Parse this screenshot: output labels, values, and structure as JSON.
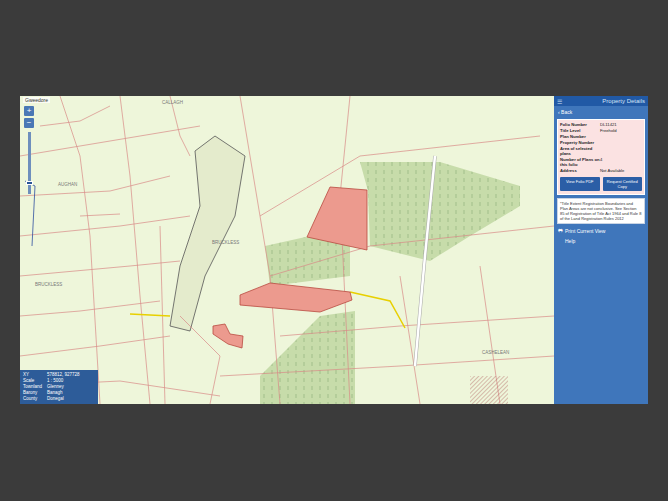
{
  "window": {
    "background": "map"
  },
  "map": {
    "search": "Gweedore",
    "zoom": {
      "in": "+",
      "out": "−",
      "level": 0.15
    },
    "labels": [
      "AUGHAN",
      "BRUCKLESS",
      "BRUCKLESS",
      "CASHELEAN",
      "CALLAGH"
    ],
    "plots": [
      {
        "selected": true
      },
      {
        "selected": true
      },
      {
        "selected": true
      }
    ],
    "info": [
      {
        "label": "XY",
        "value": "578812, 927728"
      },
      {
        "label": "Scale",
        "value": "1 : 5000"
      },
      {
        "label": "Townland",
        "value": "Glenney"
      },
      {
        "label": "Barony",
        "value": "Banagh"
      },
      {
        "label": "County",
        "value": "Donegal"
      }
    ]
  },
  "panel": {
    "menu": "☰",
    "title": "Property Details",
    "back": "‹ Back",
    "fields": [
      {
        "label": "Folio Number",
        "value": "DL11421"
      },
      {
        "label": "Title Level",
        "value": "Freehold"
      },
      {
        "label": "Plan Number",
        "value": ""
      },
      {
        "label": "Property Number",
        "value": ""
      },
      {
        "label": "Area of selected plans",
        "value": ""
      },
      {
        "label": "Number of Plans on this folio",
        "value": "4"
      },
      {
        "label": "Address",
        "value": "Not Available"
      }
    ],
    "buttons": [
      "View Folio PDF",
      "Request Certified Copy"
    ],
    "note": "*Title Extent Registration Boundaries and Plan Areas are not conclusive. See Section 85 of Registration of Title Act 1964 and Rule 8 of the Land Registration Rules 2012",
    "links": [
      {
        "icon": "🖶",
        "label": "Print Current View"
      },
      {
        "icon": "",
        "label": "Help"
      }
    ]
  }
}
